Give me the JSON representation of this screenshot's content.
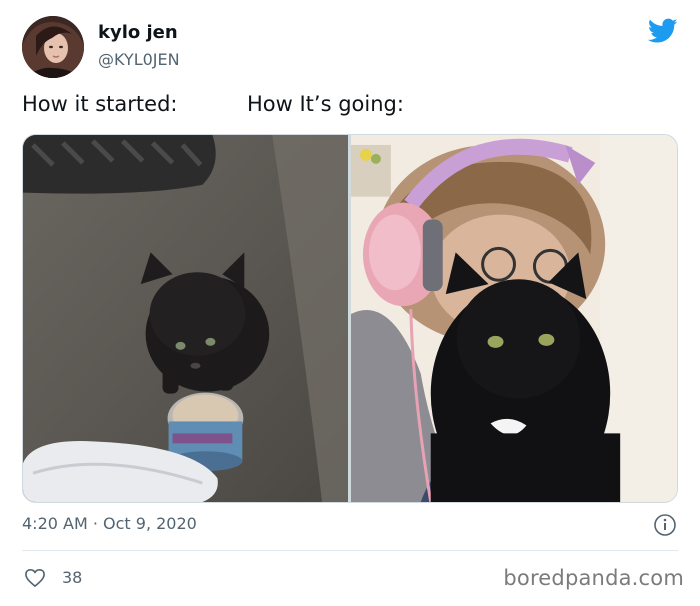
{
  "author": {
    "display_name": "kylo jen",
    "handle": "@KYL0JEN"
  },
  "tweet": {
    "text_left": "How it started:",
    "text_right": "How It’s going:",
    "timestamp": "4:20 AM · Oct 9, 2020"
  },
  "media": {
    "images": [
      {
        "name": "kitten-eating"
      },
      {
        "name": "cat-with-owner-headphones"
      }
    ]
  },
  "engagement": {
    "likes": "38"
  },
  "watermark": "boredpanda.com",
  "colors": {
    "twitter_blue": "#1d9bf0",
    "secondary_text": "#536471",
    "border": "#cfd9de"
  },
  "icons": [
    "twitter-bird-icon",
    "info-icon",
    "heart-icon"
  ]
}
